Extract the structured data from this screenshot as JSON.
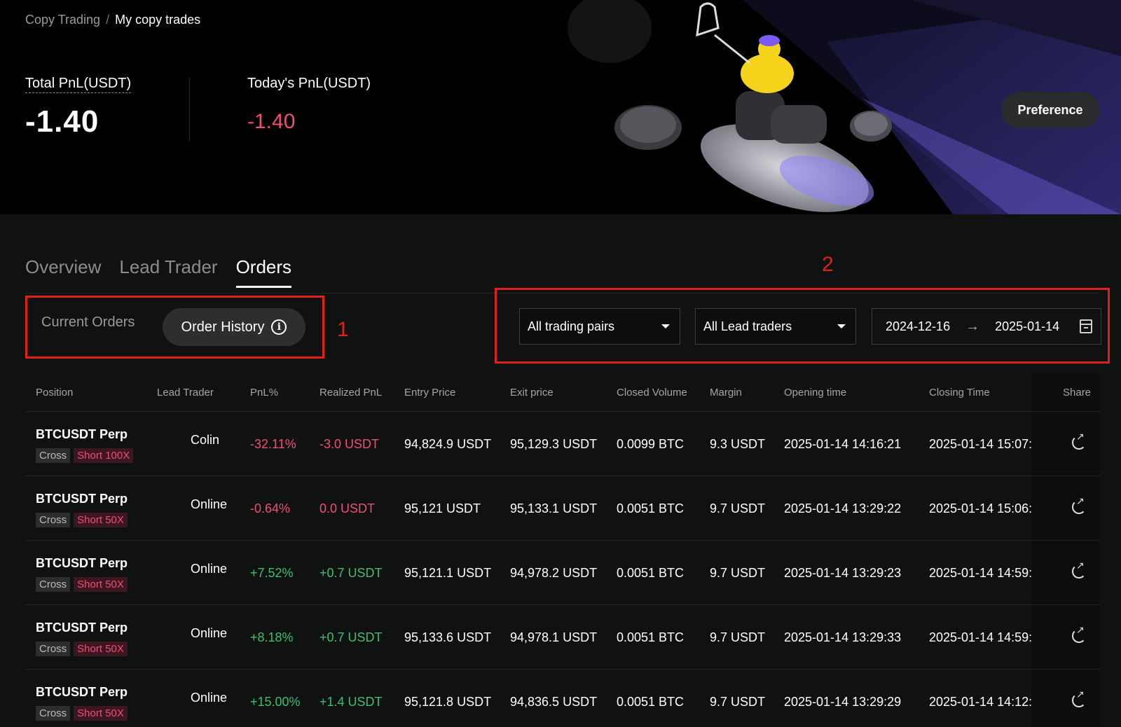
{
  "breadcrumb": {
    "parent": "Copy Trading",
    "separator": "/",
    "current": "My copy trades"
  },
  "summary": {
    "total_pnl_label": "Total PnL(USDT)",
    "total_pnl_value": "-1.40",
    "today_pnl_label": "Today's PnL(USDT)",
    "today_pnl_value": "-1.40"
  },
  "preference_label": "Preference",
  "tabs": [
    {
      "label": "Overview",
      "active": false
    },
    {
      "label": "Lead Trader",
      "active": false
    },
    {
      "label": "Orders",
      "active": true
    }
  ],
  "subtabs": {
    "current": "Current Orders",
    "history": "Order History",
    "history_icon": "info-icon"
  },
  "annotations": {
    "one": "1",
    "two": "2"
  },
  "filters": {
    "pairs": "All trading pairs",
    "traders": "All Lead traders",
    "date_start": "2024-12-16",
    "date_arrow": "→",
    "date_end": "2025-01-14",
    "calendar_icon": "calendar-icon"
  },
  "table": {
    "headers": [
      "Position",
      "Lead Trader",
      "PnL%",
      "Realized PnL",
      "Entry Price",
      "Exit price",
      "Closed Volume",
      "Margin",
      "Opening time",
      "Closing Time",
      "Share"
    ],
    "rows": [
      {
        "position": "BTCUSDT Perp",
        "margin_mode": "Cross",
        "side": "Short 100X",
        "trader": "Colin",
        "pnl_pct": "-32.11%",
        "realized": "-3.0 USDT",
        "entry": "94,824.9 USDT",
        "exit": "95,129.3 USDT",
        "volume": "0.0099 BTC",
        "margin": "9.3 USDT",
        "open_time": "2025-01-14 14:16:21",
        "close_time": "2025-01-14 15:07:",
        "trend": "neg"
      },
      {
        "position": "BTCUSDT Perp",
        "margin_mode": "Cross",
        "side": "Short 50X",
        "trader": "Online",
        "pnl_pct": "-0.64%",
        "realized": "0.0 USDT",
        "entry": "95,121 USDT",
        "exit": "95,133.1 USDT",
        "volume": "0.0051 BTC",
        "margin": "9.7 USDT",
        "open_time": "2025-01-14 13:29:22",
        "close_time": "2025-01-14 15:06:",
        "trend": "neg"
      },
      {
        "position": "BTCUSDT Perp",
        "margin_mode": "Cross",
        "side": "Short 50X",
        "trader": "Online",
        "pnl_pct": "+7.52%",
        "realized": "+0.7 USDT",
        "entry": "95,121.1 USDT",
        "exit": "94,978.2 USDT",
        "volume": "0.0051 BTC",
        "margin": "9.7 USDT",
        "open_time": "2025-01-14 13:29:23",
        "close_time": "2025-01-14 14:59:",
        "trend": "pos"
      },
      {
        "position": "BTCUSDT Perp",
        "margin_mode": "Cross",
        "side": "Short 50X",
        "trader": "Online",
        "pnl_pct": "+8.18%",
        "realized": "+0.7 USDT",
        "entry": "95,133.6 USDT",
        "exit": "94,978.1 USDT",
        "volume": "0.0051 BTC",
        "margin": "9.7 USDT",
        "open_time": "2025-01-14 13:29:33",
        "close_time": "2025-01-14 14:59:",
        "trend": "pos"
      },
      {
        "position": "BTCUSDT Perp",
        "margin_mode": "Cross",
        "side": "Short 50X",
        "trader": "Online",
        "pnl_pct": "+15.00%",
        "realized": "+1.4 USDT",
        "entry": "95,121.8 USDT",
        "exit": "94,836.5 USDT",
        "volume": "0.0051 BTC",
        "margin": "9.7 USDT",
        "open_time": "2025-01-14 13:29:29",
        "close_time": "2025-01-14 14:12:",
        "trend": "pos"
      }
    ]
  },
  "colors": {
    "negative": "#ef4f72",
    "positive": "#3fbe72",
    "highlight_box": "#e0201b"
  }
}
